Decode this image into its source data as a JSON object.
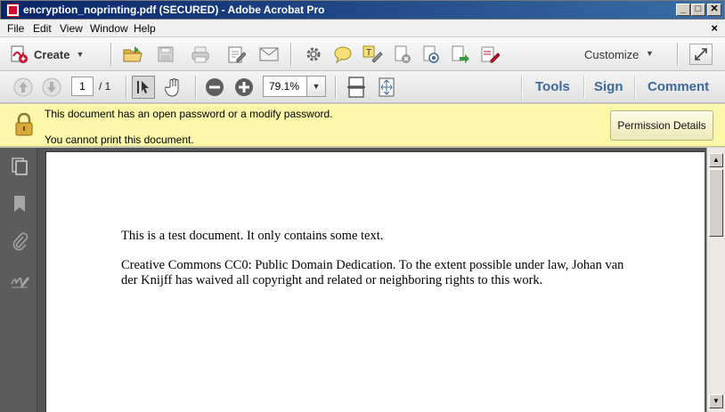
{
  "window": {
    "title": "encryption_noprinting.pdf (SECURED) - Adobe Acrobat Pro",
    "minimize": "_",
    "maximize": "□",
    "close": "✕"
  },
  "menu": {
    "items": [
      "File",
      "Edit",
      "View",
      "Window",
      "Help"
    ],
    "close_doc": "×"
  },
  "toolbar": {
    "create_label": "Create",
    "customize_label": "Customize",
    "icons": [
      "open-folder-icon",
      "save-icon",
      "print-icon",
      "edit-form-icon",
      "email-icon",
      "settings-gear-icon",
      "comment-bubble-icon",
      "highlight-text-icon",
      "secure-icon",
      "sign-icon",
      "share-icon",
      "fill-sign-icon",
      "expand-icon"
    ]
  },
  "nav": {
    "current_page": "1",
    "total_pages": "/ 1",
    "zoom": "79.1%"
  },
  "panes": {
    "tools": "Tools",
    "sign": "Sign",
    "comment": "Comment"
  },
  "banner": {
    "line1": "This document has an open password or a modify password.",
    "line2": "You cannot print this document.",
    "button": "Permission Details"
  },
  "document": {
    "para1": "This is a test document. It only contains some text.",
    "para2_line1": "Creative Commons CC0: Public Domain Dedication. To the extent possible under law, Johan van",
    "para2_line2": "der Knijff has waived all copyright and related or neighboring rights to this work."
  },
  "colors": {
    "banner_bg": "#fbf7a8",
    "pane_link": "#3c6a9a",
    "nav_bg": "#5c5c5c"
  }
}
